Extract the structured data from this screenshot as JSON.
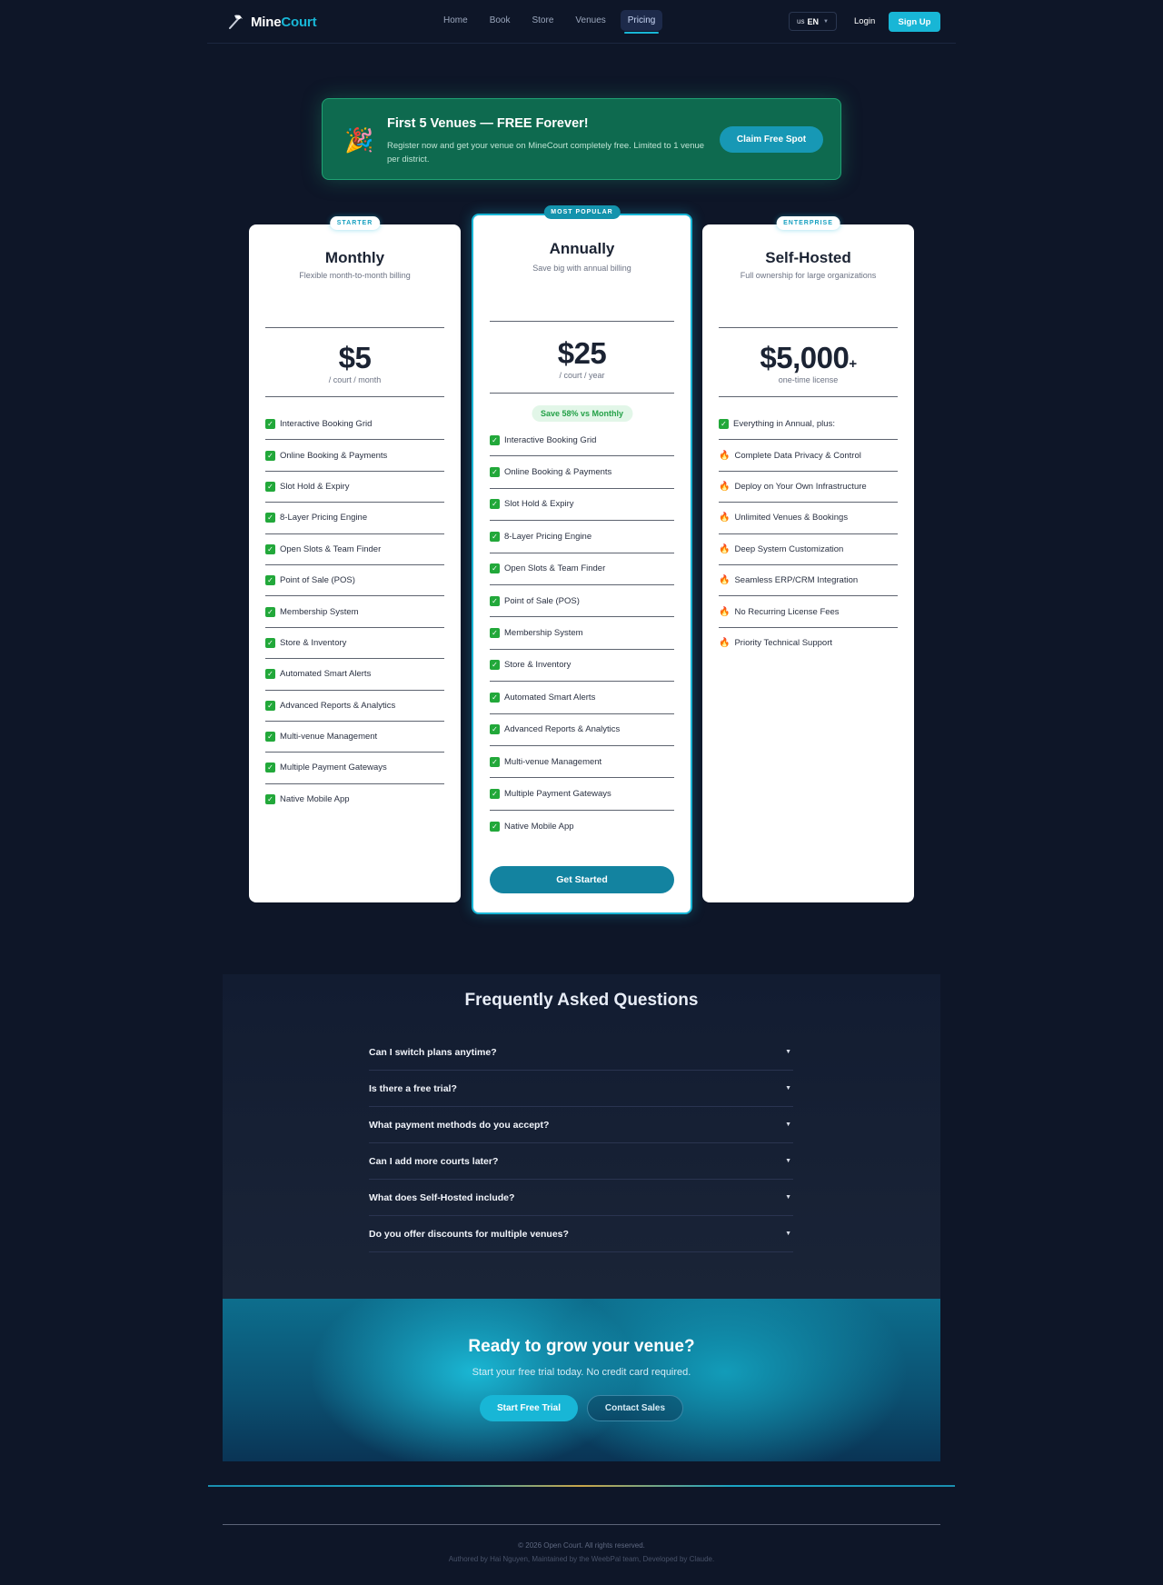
{
  "nav": {
    "brand_part1": "Mine",
    "brand_part2": "Court",
    "brand_icon": "pickaxe-icon",
    "links": [
      "Home",
      "Book",
      "Store",
      "Venues",
      "Pricing"
    ],
    "active_link": "Pricing",
    "lang_flag": "us",
    "lang_code": "EN",
    "login": "Login",
    "signup": "Sign Up"
  },
  "promo": {
    "icon": "party-popper-icon",
    "title": "First 5 Venues — FREE Forever!",
    "text": "Register now and get your venue on MineCourt completely free. Limited to 1 venue per district.",
    "button": "Claim Free Spot"
  },
  "plans": {
    "monthly": {
      "badge": "STARTER",
      "title": "Monthly",
      "subtitle": "Flexible month-to-month billing",
      "price": "$5",
      "unit": "/ court / month",
      "features": [
        "Interactive Booking Grid",
        "Online Booking & Payments",
        "Slot Hold & Expiry",
        "8-Layer Pricing Engine",
        "Open Slots & Team Finder",
        "Point of Sale (POS)",
        "Membership System",
        "Store & Inventory",
        "Automated Smart Alerts",
        "Advanced Reports & Analytics",
        "Multi-venue Management",
        "Multiple Payment Gateways",
        "Native Mobile App"
      ]
    },
    "annual": {
      "badge": "MOST POPULAR",
      "title": "Annually",
      "subtitle": "Save big with annual billing",
      "price": "$25",
      "unit": "/ court / year",
      "save": "Save 58% vs Monthly",
      "features": [
        "Interactive Booking Grid",
        "Online Booking & Payments",
        "Slot Hold & Expiry",
        "8-Layer Pricing Engine",
        "Open Slots & Team Finder",
        "Point of Sale (POS)",
        "Membership System",
        "Store & Inventory",
        "Automated Smart Alerts",
        "Advanced Reports & Analytics",
        "Multi-venue Management",
        "Multiple Payment Gateways",
        "Native Mobile App"
      ],
      "cta": "Get Started"
    },
    "selfhost": {
      "badge": "ENTERPRISE",
      "title": "Self-Hosted",
      "subtitle": "Full ownership for large organizations",
      "price": "$5,000",
      "price_suffix": "+",
      "unit": "one-time license",
      "first_feature": "Everything in Annual, plus:",
      "features": [
        "Complete Data Privacy & Control",
        "Deploy on Your Own Infrastructure",
        "Unlimited Venues & Bookings",
        "Deep System Customization",
        "Seamless ERP/CRM Integration",
        "No Recurring License Fees",
        "Priority Technical Support"
      ]
    }
  },
  "colors": {
    "accent": "#18b6d6",
    "check_green": "#22a83a",
    "promo_green": "#0e6a4f",
    "background": "#0e1628"
  },
  "faq": {
    "title": "Frequently Asked Questions",
    "items": [
      "Can I switch plans anytime?",
      "Is there a free trial?",
      "What payment methods do you accept?",
      "Can I add more courts later?",
      "What does Self-Hosted include?",
      "Do you offer discounts for multiple venues?"
    ]
  },
  "cta": {
    "title": "Ready to grow your venue?",
    "subtitle": "Start your free trial today. No credit card required.",
    "primary": "Start Free Trial",
    "secondary": "Contact Sales"
  },
  "footer": {
    "copyright": "© 2026 Open Court. All rights reserved.",
    "authored": "Authored by Hai Nguyen, Maintained by the WeebPal team, Developed by Claude."
  }
}
